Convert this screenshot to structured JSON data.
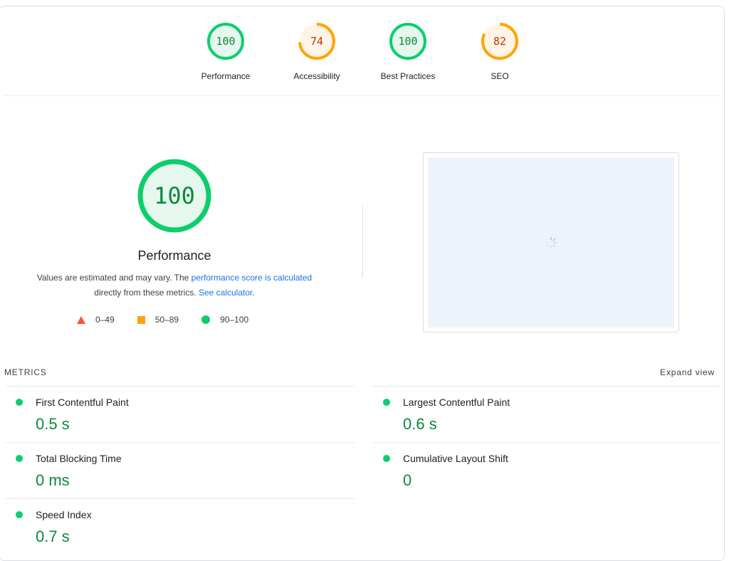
{
  "categories": [
    {
      "label": "Performance",
      "score": "100",
      "fraction": 1.0,
      "status": "pass",
      "color": "#0cce6b",
      "bg": "#e6f7ee",
      "text_color": "#0a8a3a"
    },
    {
      "label": "Accessibility",
      "score": "74",
      "fraction": 0.74,
      "status": "average",
      "color": "#ffa400",
      "bg": "#fff4e5",
      "text_color": "#c33300"
    },
    {
      "label": "Best Practices",
      "score": "100",
      "fraction": 1.0,
      "status": "pass",
      "color": "#0cce6b",
      "bg": "#e6f7ee",
      "text_color": "#0a8a3a"
    },
    {
      "label": "SEO",
      "score": "82",
      "fraction": 0.82,
      "status": "average",
      "color": "#ffa400",
      "bg": "#fff4e5",
      "text_color": "#c33300"
    }
  ],
  "performance": {
    "score": "100",
    "title": "Performance",
    "desc_prefix": "Values are estimated and may vary. The ",
    "desc_link1": "performance score is calculated",
    "desc_mid": "directly from these metrics. ",
    "desc_link2": "See calculator",
    "desc_suffix": "."
  },
  "legend": [
    {
      "range": "0–49",
      "shape": "triangle",
      "color": "#ff4e42"
    },
    {
      "range": "50–89",
      "shape": "square",
      "color": "#ffa400"
    },
    {
      "range": "90–100",
      "shape": "circle",
      "color": "#0cce6b"
    }
  ],
  "metrics": {
    "heading": "METRICS",
    "expand_label": "Expand view",
    "left": [
      {
        "title": "First Contentful Paint",
        "value": "0.5 s"
      },
      {
        "title": "Total Blocking Time",
        "value": "0 ms"
      },
      {
        "title": "Speed Index",
        "value": "0.7 s"
      }
    ],
    "right": [
      {
        "title": "Largest Contentful Paint",
        "value": "0.6 s"
      },
      {
        "title": "Cumulative Layout Shift",
        "value": "0"
      }
    ]
  },
  "screenshot": {
    "state": "loading",
    "icon": "spinner-icon"
  }
}
